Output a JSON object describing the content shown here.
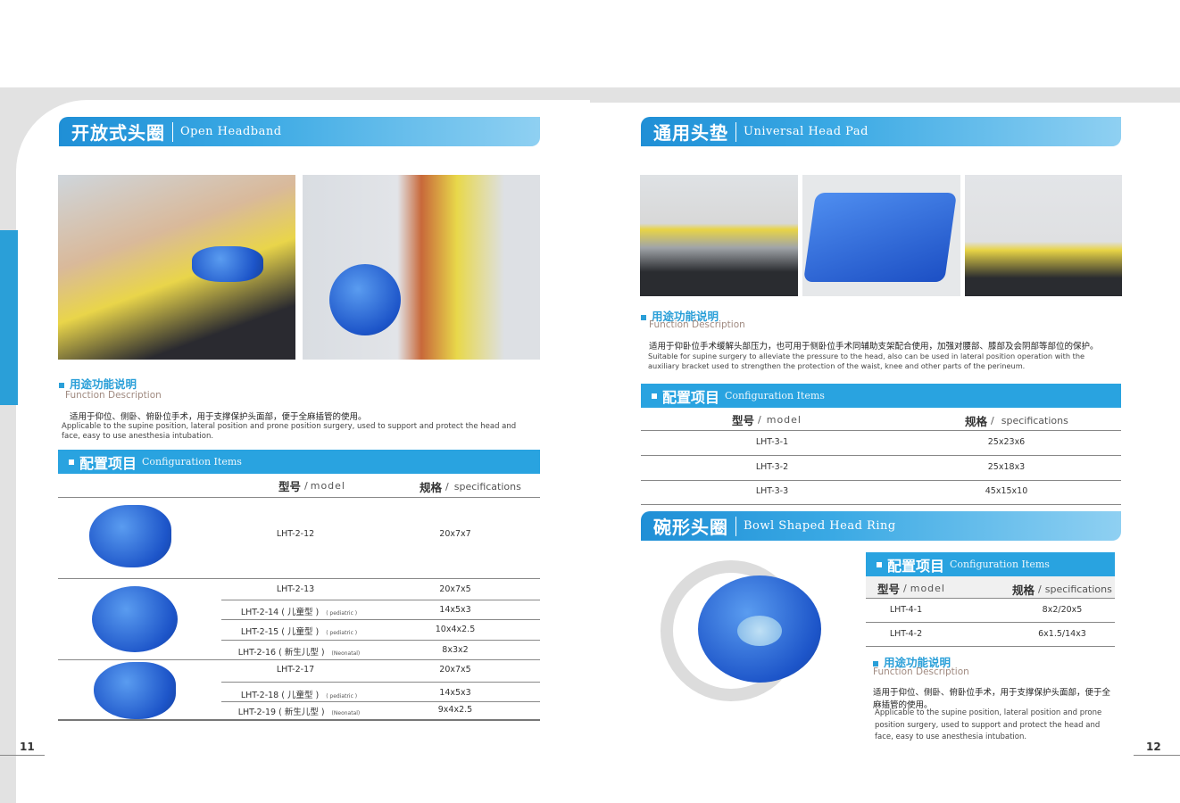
{
  "left_page": {
    "page_number": "11",
    "section": {
      "title_cn": "开放式头圈",
      "title_en": "Open Headband"
    },
    "function": {
      "title_cn": "用途功能说明",
      "title_en": "Function Description",
      "desc_cn": "适用于仰位、侧卧、俯卧位手术，用于支撑保护头面部，便于全麻插管的使用。",
      "desc_en": "Applicable to the supine position, lateral position and prone position surgery, used to support and protect the head and face, easy to use anesthesia intubation."
    },
    "config": {
      "title_cn": "配置项目",
      "title_en": "Configuration Items",
      "col_model_cn": "型号",
      "col_model_en": "model",
      "col_spec_cn": "规格",
      "col_spec_en": "specifications",
      "rows": [
        {
          "model": "LHT-2-12",
          "note": "",
          "spec": "20x7x7"
        },
        {
          "model": "LHT-2-13",
          "note": "",
          "spec": "20x7x5"
        },
        {
          "model": "LHT-2-14 ( 儿童型 )",
          "note": "( pediatric )",
          "spec": "14x5x3"
        },
        {
          "model": "LHT-2-15 ( 儿童型 )",
          "note": "( pediatric )",
          "spec": "10x4x2.5"
        },
        {
          "model": "LHT-2-16 ( 新生儿型 )",
          "note": "(Neonatal)",
          "spec": "8x3x2"
        },
        {
          "model": "LHT-2-17",
          "note": "",
          "spec": "20x7x5"
        },
        {
          "model": "LHT-2-18 ( 儿童型 )",
          "note": "( pediatric )",
          "spec": "14x5x3"
        },
        {
          "model": "LHT-2-19 ( 新生儿型 )",
          "note": "(Neonatal)",
          "spec": "9x4x2.5"
        }
      ]
    }
  },
  "right_page": {
    "page_number": "12",
    "section1": {
      "title_cn": "通用头垫",
      "title_en": "Universal Head Pad"
    },
    "function1": {
      "title_cn": "用途功能说明",
      "title_en": "Function Description",
      "desc_cn": "适用于仰卧位手术缓解头部压力，也可用于侧卧位手术同辅助支架配合使用，加强对腰部、膝部及会阴部等部位的保护。",
      "desc_en": "Suitable for supine surgery to alleviate the pressure to the head, also can be used in lateral position operation with the auxiliary bracket used to strengthen the protection of the waist, knee and other parts of  the perineum."
    },
    "config1": {
      "title_cn": "配置项目",
      "title_en": "Configuration Items",
      "col_model_cn": "型号",
      "col_model_en": "model",
      "col_spec_cn": "规格",
      "col_spec_en": "specifications",
      "rows": [
        {
          "model": "LHT-3-1",
          "spec": "25x23x6"
        },
        {
          "model": "LHT-3-2",
          "spec": "25x18x3"
        },
        {
          "model": "LHT-3-3",
          "spec": "45x15x10"
        }
      ]
    },
    "section2": {
      "title_cn": "碗形头圈",
      "title_en": "Bowl Shaped Head Ring"
    },
    "config2": {
      "title_cn": "配置项目",
      "title_en": "Configuration Items",
      "col_model_cn": "型号",
      "col_model_en": "model",
      "col_spec_cn": "规格",
      "col_spec_en": "specifications",
      "rows": [
        {
          "model": "LHT-4-1",
          "spec": "8x2/20x5"
        },
        {
          "model": "LHT-4-2",
          "spec": "6x1.5/14x3"
        }
      ]
    },
    "function2": {
      "title_cn": "用途功能说明",
      "title_en": "Function Description",
      "desc_cn": "适用于仰位、侧卧、俯卧位手术，用于支撑保护头面部，便于全麻插管的使用。",
      "desc_en": "Applicable to the supine position, lateral position and prone position surgery, used to support and protect the head and face, easy to use anesthesia intubation."
    }
  }
}
